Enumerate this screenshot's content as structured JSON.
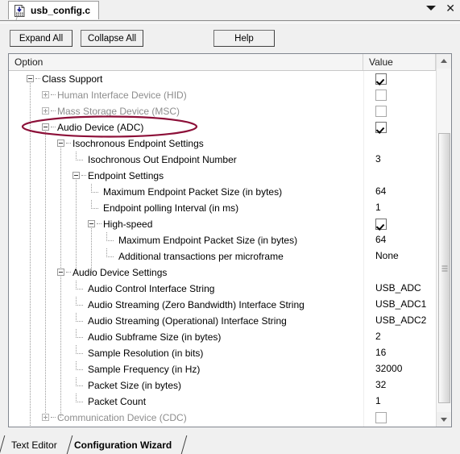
{
  "window": {
    "tab_label": "usb_config.c",
    "tab_icon": "file-download-icon",
    "dropdown_icon": "chevron-down-icon",
    "close_icon": "close-icon"
  },
  "toolbar": {
    "expand_all_label": "Expand All",
    "collapse_all_label": "Collapse All",
    "help_label": "Help"
  },
  "tree": {
    "columns": {
      "option": "Option",
      "value": "Value"
    },
    "rows": [
      {
        "label": "Class Support",
        "depth": 0,
        "expander": "minus",
        "value": "",
        "value_type": "checkbox",
        "checked": true,
        "dim": false
      },
      {
        "label": "Human Interface Device (HID)",
        "depth": 1,
        "expander": "plus",
        "value": "",
        "value_type": "checkbox",
        "checked": false,
        "dim": true
      },
      {
        "label": "Mass Storage Device (MSC)",
        "depth": 1,
        "expander": "plus",
        "value": "",
        "value_type": "checkbox",
        "checked": false,
        "dim": true
      },
      {
        "label": "Audio Device (ADC)",
        "depth": 1,
        "expander": "minus",
        "value": "",
        "value_type": "checkbox",
        "checked": true,
        "dim": false
      },
      {
        "label": "Isochronous Endpoint Settings",
        "depth": 2,
        "expander": "minus",
        "value": "",
        "value_type": "none",
        "checked": false,
        "dim": false
      },
      {
        "label": "Isochronous Out Endpoint Number",
        "depth": 3,
        "expander": "leaf",
        "value": "3",
        "value_type": "text",
        "checked": false,
        "dim": false
      },
      {
        "label": "Endpoint Settings",
        "depth": 3,
        "expander": "minus",
        "value": "",
        "value_type": "none",
        "checked": false,
        "dim": false
      },
      {
        "label": "Maximum Endpoint Packet Size (in bytes)",
        "depth": 4,
        "expander": "leaf",
        "value": "64",
        "value_type": "text",
        "checked": false,
        "dim": false
      },
      {
        "label": "Endpoint polling Interval (in ms)",
        "depth": 4,
        "expander": "leaf",
        "value": "1",
        "value_type": "text",
        "checked": false,
        "dim": false
      },
      {
        "label": "High-speed",
        "depth": 4,
        "expander": "minus",
        "value": "",
        "value_type": "checkbox",
        "checked": true,
        "dim": false
      },
      {
        "label": "Maximum Endpoint Packet Size (in bytes)",
        "depth": 5,
        "expander": "leaf",
        "value": "64",
        "value_type": "text",
        "checked": false,
        "dim": false
      },
      {
        "label": "Additional transactions per microframe",
        "depth": 5,
        "expander": "leaf",
        "value": "None",
        "value_type": "text",
        "checked": false,
        "dim": false
      },
      {
        "label": "Audio Device Settings",
        "depth": 2,
        "expander": "minus",
        "value": "",
        "value_type": "none",
        "checked": false,
        "dim": false
      },
      {
        "label": "Audio Control Interface String",
        "depth": 3,
        "expander": "leaf",
        "value": "USB_ADC",
        "value_type": "text",
        "checked": false,
        "dim": false
      },
      {
        "label": "Audio Streaming (Zero Bandwidth) Interface String",
        "depth": 3,
        "expander": "leaf",
        "value": "USB_ADC1",
        "value_type": "text",
        "checked": false,
        "dim": false
      },
      {
        "label": "Audio Streaming (Operational) Interface String",
        "depth": 3,
        "expander": "leaf",
        "value": "USB_ADC2",
        "value_type": "text",
        "checked": false,
        "dim": false
      },
      {
        "label": "Audio Subframe Size (in bytes)",
        "depth": 3,
        "expander": "leaf",
        "value": "2",
        "value_type": "text",
        "checked": false,
        "dim": false
      },
      {
        "label": "Sample Resolution (in bits)",
        "depth": 3,
        "expander": "leaf",
        "value": "16",
        "value_type": "text",
        "checked": false,
        "dim": false
      },
      {
        "label": "Sample Frequency (in Hz)",
        "depth": 3,
        "expander": "leaf",
        "value": "32000",
        "value_type": "text",
        "checked": false,
        "dim": false
      },
      {
        "label": "Packet Size (in bytes)",
        "depth": 3,
        "expander": "leaf",
        "value": "32",
        "value_type": "text",
        "checked": false,
        "dim": false
      },
      {
        "label": "Packet Count",
        "depth": 3,
        "expander": "leaf",
        "value": "1",
        "value_type": "text",
        "checked": false,
        "dim": false
      },
      {
        "label": "Communication Device (CDC)",
        "depth": 1,
        "expander": "plus",
        "value": "",
        "value_type": "checkbox",
        "checked": false,
        "dim": true
      }
    ]
  },
  "annotation": {
    "shape": "ellipse",
    "color": "#8c0f38",
    "target_row_label": "Audio Device (ADC)"
  },
  "bottom_tabs": [
    {
      "label": "Text Editor",
      "active": false
    },
    {
      "label": "Configuration Wizard",
      "active": true
    }
  ],
  "scrollbar": {
    "up_icon": "triangle-up-icon",
    "down_icon": "triangle-down-icon",
    "grip_icon": "grip-lines-icon"
  }
}
